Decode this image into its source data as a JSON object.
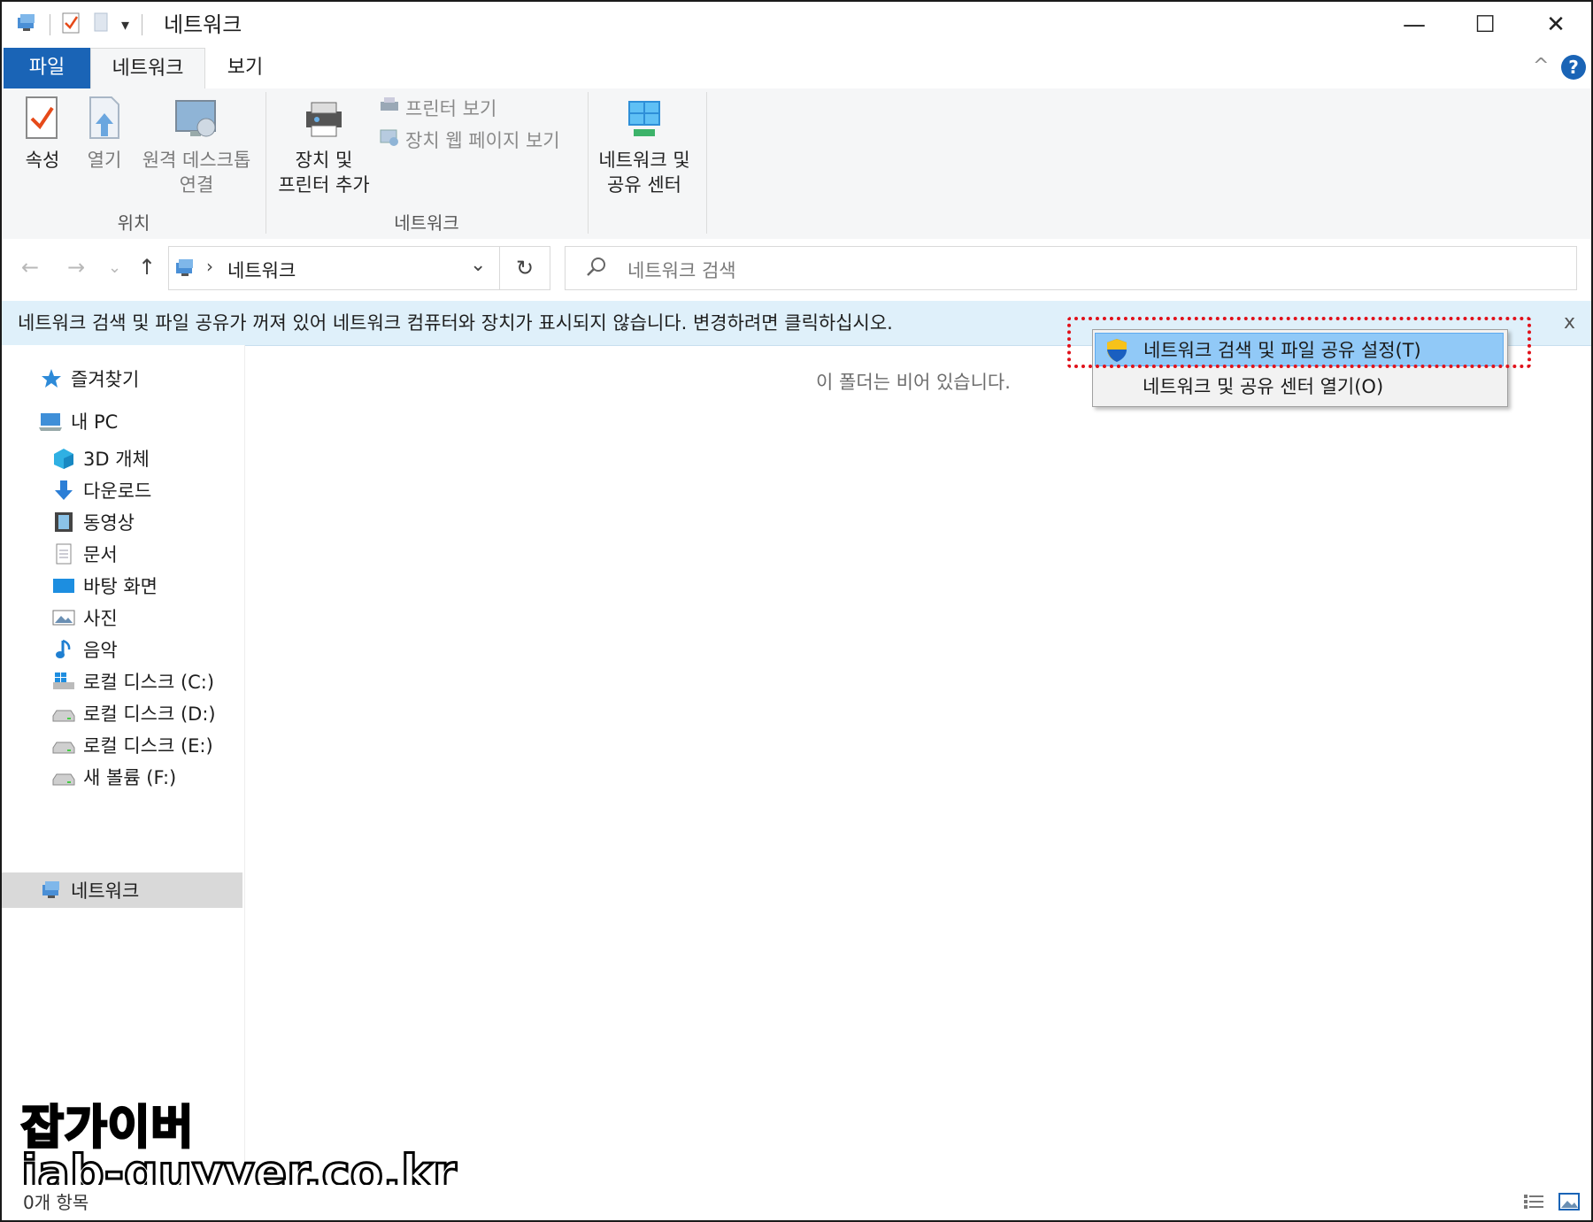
{
  "window": {
    "title": "네트워크",
    "qa_dropdown": "▾",
    "controls": {
      "minimize": "—",
      "maximize": "☐",
      "close": "✕"
    }
  },
  "ribbon_tabs": {
    "file": "파일",
    "network": "네트워크",
    "view": "보기",
    "collapse": "^",
    "help": "?"
  },
  "ribbon": {
    "properties": "속성",
    "open": "열기",
    "remote_desktop": [
      "원격 데스크톱",
      "연결"
    ],
    "add_devices": [
      "장치 및",
      "프린터 추가"
    ],
    "view_printers": "프린터 보기",
    "view_device_webpage": "장치 웹 페이지 보기",
    "network_center": [
      "네트워크 및",
      "공유 센터"
    ],
    "group_location": "위치",
    "group_network": "네트워크"
  },
  "navigation": {
    "back": "←",
    "forward": "→",
    "recent": "⌄",
    "up": "↑",
    "breadcrumb_sep": "›",
    "address": "네트워크",
    "address_dropdown": "⌄",
    "refresh": "↻",
    "search_placeholder": "네트워크 검색"
  },
  "infobar": {
    "message": "네트워크 검색 및 파일 공유가 꺼져 있어 네트워크 컴퓨터와 장치가 표시되지 않습니다. 변경하려면 클릭하십시오.",
    "close": "x"
  },
  "context_menu": {
    "items": [
      {
        "label": "네트워크 검색 및 파일 공유 설정(T)",
        "icon": "shield-icon",
        "highlighted": true
      },
      {
        "label": "네트워크 및 공유 센터 열기(O)",
        "icon": "",
        "highlighted": false
      }
    ]
  },
  "sidebar": {
    "favorites": "즐겨찾기",
    "this_pc": "내 PC",
    "items": [
      {
        "label": "3D 개체",
        "icon": "cube-icon"
      },
      {
        "label": "다운로드",
        "icon": "download-icon"
      },
      {
        "label": "동영상",
        "icon": "video-icon"
      },
      {
        "label": "문서",
        "icon": "document-icon"
      },
      {
        "label": "바탕 화면",
        "icon": "desktop-icon"
      },
      {
        "label": "사진",
        "icon": "picture-icon"
      },
      {
        "label": "음악",
        "icon": "music-icon"
      },
      {
        "label": "로컬 디스크 (C:)",
        "icon": "system-drive-icon"
      },
      {
        "label": "로컬 디스크 (D:)",
        "icon": "drive-icon"
      },
      {
        "label": "로컬 디스크 (E:)",
        "icon": "drive-icon"
      },
      {
        "label": "새 볼륨 (F:)",
        "icon": "drive-icon"
      }
    ],
    "network": "네트워크"
  },
  "content": {
    "empty_message": "이 폴더는 비어 있습니다."
  },
  "status": {
    "item_count": "0개 항목"
  },
  "watermark": {
    "line1": "잡가이버",
    "line2": "jab-guyver.co.kr"
  },
  "colors": {
    "file_tab": "#1a64b6",
    "infobar": "#dff0fa",
    "menu_highlight": "#91c9f7",
    "annotation": "#e0111a"
  }
}
